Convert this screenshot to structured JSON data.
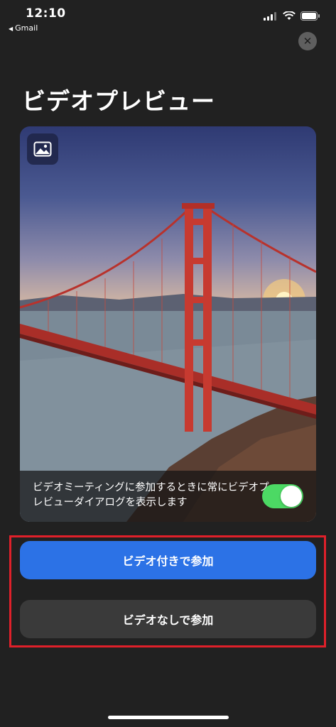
{
  "status_bar": {
    "time": "12:10",
    "back_app": "Gmail",
    "icons": [
      "signal-icon",
      "wifi-icon",
      "battery-icon"
    ]
  },
  "header": {
    "title": "ビデオプレビュー",
    "close_icon": "close-icon"
  },
  "preview": {
    "background_button_icon": "image-icon",
    "setting_text": "ビデオミーティングに参加するときに常にビデオプレビューダイアログを表示します",
    "toggle_on": true
  },
  "actions": {
    "join_with_video": "ビデオ付きで参加",
    "join_without_video": "ビデオなしで参加"
  },
  "colors": {
    "background": "#212121",
    "primary_button": "#2c72e6",
    "secondary_button": "#3a3a3a",
    "toggle_on": "#4cd964",
    "highlight": "#e0202a"
  }
}
